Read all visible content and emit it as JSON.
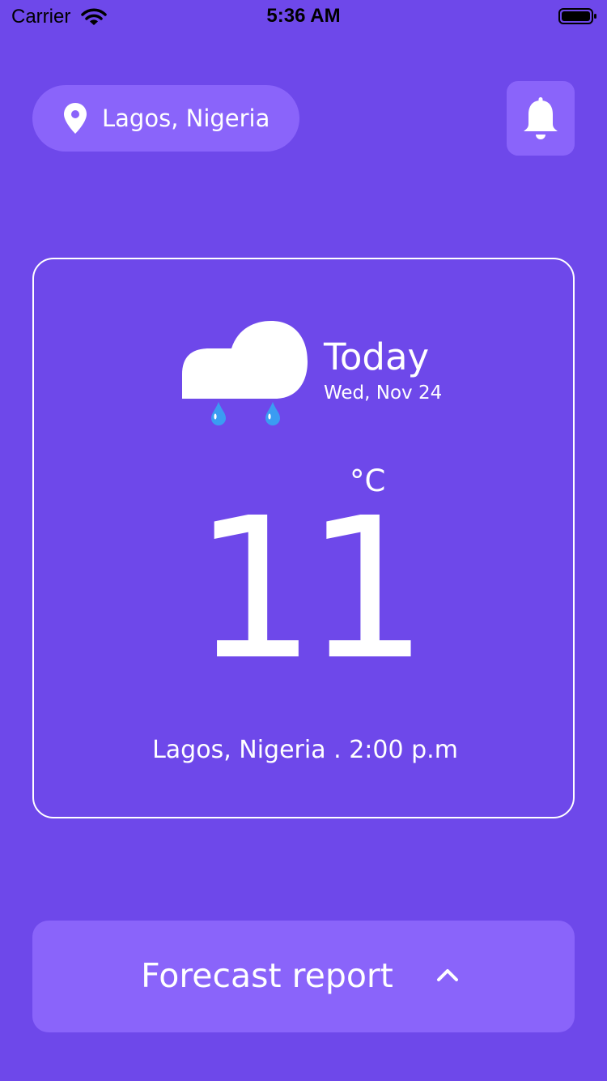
{
  "status_bar": {
    "carrier": "Carrier",
    "time": "5:36 AM",
    "icons": [
      "wifi-icon",
      "battery-icon"
    ]
  },
  "header": {
    "location": "Lagos, Nigeria",
    "location_icon": "map-pin-icon",
    "notification_icon": "bell-icon"
  },
  "weather_card": {
    "condition_icon": "rain-cloud-icon",
    "day_label": "Today",
    "date": "Wed, Nov 24",
    "unit": "°C",
    "temperature": "11",
    "footer": "Lagos, Nigeria . 2:00 p.m"
  },
  "forecast": {
    "label": "Forecast report",
    "icon": "chevron-up-icon"
  },
  "colors": {
    "background": "#6e48ea",
    "pill": "#8a64fa",
    "text": "#ffffff",
    "raindrop": "#3b9cf2"
  }
}
